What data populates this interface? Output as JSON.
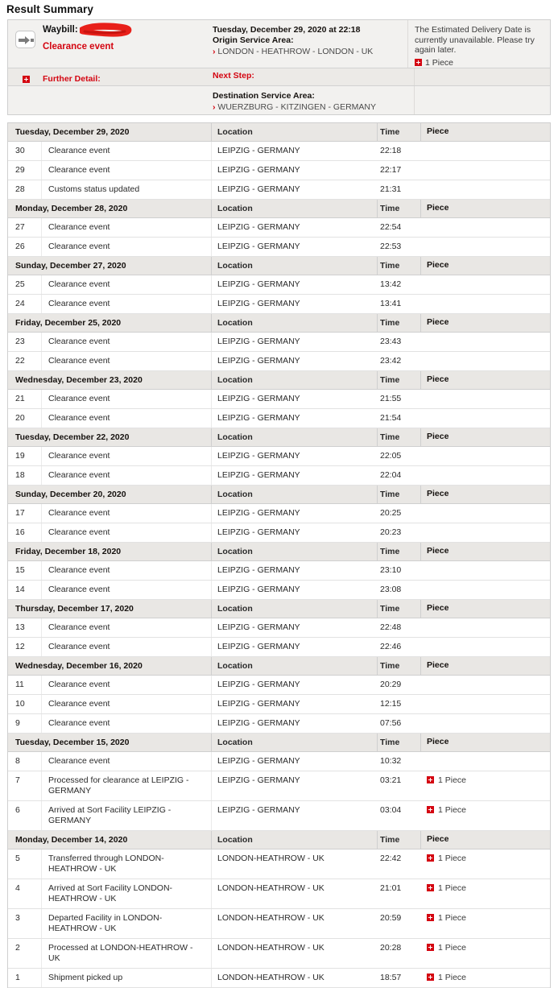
{
  "page_title": "Result Summary",
  "summary": {
    "status_icon": "shipment-arrow-icon",
    "waybill_label": "Waybill:",
    "waybill_value_redacted": true,
    "status_text": "Clearance event",
    "further_detail_label": "Further Detail:",
    "event_datetime": "Tuesday, December 29, 2020 at 22:18",
    "origin_label": "Origin Service Area:",
    "origin_value": "LONDON - HEATHROW - LONDON - UK",
    "next_step_label": "Next Step:",
    "destination_label": "Destination Service Area:",
    "destination_value": "WUERZBURG - KITZINGEN - GERMANY",
    "delivery_notice": "The Estimated Delivery Date is currently unavailable. Please try again later.",
    "piece_count_text": "1 Piece",
    "chevron": "›",
    "accent_color": "#d40511"
  },
  "table": {
    "columns": [
      "Location",
      "Time",
      "Piece"
    ],
    "groups": [
      {
        "date": "Tuesday, December 29, 2020",
        "events": [
          {
            "num": "30",
            "desc": "Clearance event",
            "location": "LEIPZIG - GERMANY",
            "time": "22:18",
            "piece": ""
          },
          {
            "num": "29",
            "desc": "Clearance event",
            "location": "LEIPZIG - GERMANY",
            "time": "22:17",
            "piece": ""
          },
          {
            "num": "28",
            "desc": "Customs status updated",
            "location": "LEIPZIG - GERMANY",
            "time": "21:31",
            "piece": ""
          }
        ]
      },
      {
        "date": "Monday, December 28, 2020",
        "events": [
          {
            "num": "27",
            "desc": "Clearance event",
            "location": "LEIPZIG - GERMANY",
            "time": "22:54",
            "piece": ""
          },
          {
            "num": "26",
            "desc": "Clearance event",
            "location": "LEIPZIG - GERMANY",
            "time": "22:53",
            "piece": ""
          }
        ]
      },
      {
        "date": "Sunday, December 27, 2020",
        "events": [
          {
            "num": "25",
            "desc": "Clearance event",
            "location": "LEIPZIG - GERMANY",
            "time": "13:42",
            "piece": ""
          },
          {
            "num": "24",
            "desc": "Clearance event",
            "location": "LEIPZIG - GERMANY",
            "time": "13:41",
            "piece": ""
          }
        ]
      },
      {
        "date": "Friday, December 25, 2020",
        "events": [
          {
            "num": "23",
            "desc": "Clearance event",
            "location": "LEIPZIG - GERMANY",
            "time": "23:43",
            "piece": ""
          },
          {
            "num": "22",
            "desc": "Clearance event",
            "location": "LEIPZIG - GERMANY",
            "time": "23:42",
            "piece": ""
          }
        ]
      },
      {
        "date": "Wednesday, December 23, 2020",
        "events": [
          {
            "num": "21",
            "desc": "Clearance event",
            "location": "LEIPZIG - GERMANY",
            "time": "21:55",
            "piece": ""
          },
          {
            "num": "20",
            "desc": "Clearance event",
            "location": "LEIPZIG - GERMANY",
            "time": "21:54",
            "piece": ""
          }
        ]
      },
      {
        "date": "Tuesday, December 22, 2020",
        "events": [
          {
            "num": "19",
            "desc": "Clearance event",
            "location": "LEIPZIG - GERMANY",
            "time": "22:05",
            "piece": ""
          },
          {
            "num": "18",
            "desc": "Clearance event",
            "location": "LEIPZIG - GERMANY",
            "time": "22:04",
            "piece": ""
          }
        ]
      },
      {
        "date": "Sunday, December 20, 2020",
        "events": [
          {
            "num": "17",
            "desc": "Clearance event",
            "location": "LEIPZIG - GERMANY",
            "time": "20:25",
            "piece": ""
          },
          {
            "num": "16",
            "desc": "Clearance event",
            "location": "LEIPZIG - GERMANY",
            "time": "20:23",
            "piece": ""
          }
        ]
      },
      {
        "date": "Friday, December 18, 2020",
        "events": [
          {
            "num": "15",
            "desc": "Clearance event",
            "location": "LEIPZIG - GERMANY",
            "time": "23:10",
            "piece": ""
          },
          {
            "num": "14",
            "desc": "Clearance event",
            "location": "LEIPZIG - GERMANY",
            "time": "23:08",
            "piece": ""
          }
        ]
      },
      {
        "date": "Thursday, December 17, 2020",
        "events": [
          {
            "num": "13",
            "desc": "Clearance event",
            "location": "LEIPZIG - GERMANY",
            "time": "22:48",
            "piece": ""
          },
          {
            "num": "12",
            "desc": "Clearance event",
            "location": "LEIPZIG - GERMANY",
            "time": "22:46",
            "piece": ""
          }
        ]
      },
      {
        "date": "Wednesday, December 16, 2020",
        "events": [
          {
            "num": "11",
            "desc": "Clearance event",
            "location": "LEIPZIG - GERMANY",
            "time": "20:29",
            "piece": ""
          },
          {
            "num": "10",
            "desc": "Clearance event",
            "location": "LEIPZIG - GERMANY",
            "time": "12:15",
            "piece": ""
          },
          {
            "num": "9",
            "desc": "Clearance event",
            "location": "LEIPZIG - GERMANY",
            "time": "07:56",
            "piece": ""
          }
        ]
      },
      {
        "date": "Tuesday, December 15, 2020",
        "events": [
          {
            "num": "8",
            "desc": "Clearance event",
            "location": "LEIPZIG - GERMANY",
            "time": "10:32",
            "piece": ""
          },
          {
            "num": "7",
            "desc": "Processed for clearance at LEIPZIG - GERMANY",
            "location": "LEIPZIG - GERMANY",
            "time": "03:21",
            "piece": "1 Piece"
          },
          {
            "num": "6",
            "desc": "Arrived at Sort Facility LEIPZIG - GERMANY",
            "location": "LEIPZIG - GERMANY",
            "time": "03:04",
            "piece": "1 Piece"
          }
        ]
      },
      {
        "date": "Monday, December 14, 2020",
        "events": [
          {
            "num": "5",
            "desc": "Transferred through LONDON-HEATHROW - UK",
            "location": "LONDON-HEATHROW - UK",
            "time": "22:42",
            "piece": "1 Piece"
          },
          {
            "num": "4",
            "desc": "Arrived at Sort Facility LONDON-HEATHROW - UK",
            "location": "LONDON-HEATHROW - UK",
            "time": "21:01",
            "piece": "1 Piece"
          },
          {
            "num": "3",
            "desc": "Departed Facility in LONDON-HEATHROW - UK",
            "location": "LONDON-HEATHROW - UK",
            "time": "20:59",
            "piece": "1 Piece"
          },
          {
            "num": "2",
            "desc": "Processed at LONDON-HEATHROW - UK",
            "location": "LONDON-HEATHROW - UK",
            "time": "20:28",
            "piece": "1 Piece"
          },
          {
            "num": "1",
            "desc": "Shipment picked up",
            "location": "LONDON-HEATHROW - UK",
            "time": "18:57",
            "piece": "1 Piece"
          }
        ]
      }
    ]
  }
}
